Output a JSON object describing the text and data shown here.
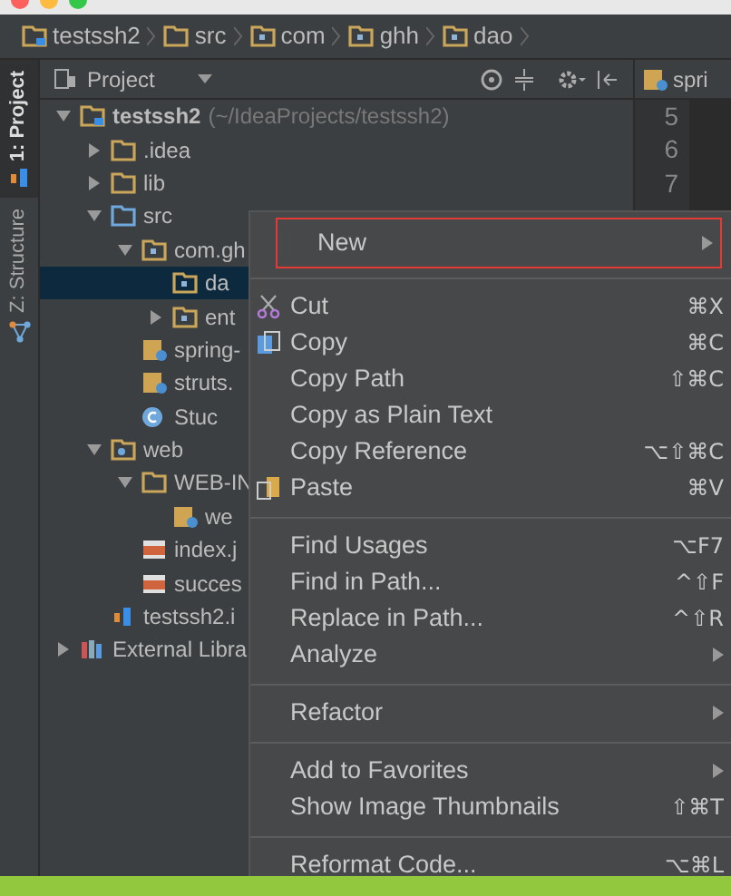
{
  "breadcrumbs": [
    {
      "label": "testssh2",
      "kind": "module"
    },
    {
      "label": "src",
      "kind": "folder"
    },
    {
      "label": "com",
      "kind": "package"
    },
    {
      "label": "ghh",
      "kind": "package"
    },
    {
      "label": "dao",
      "kind": "package"
    }
  ],
  "side_tabs": [
    {
      "label": "1: Project",
      "selected": true
    },
    {
      "label": "Z: Structure",
      "selected": false
    }
  ],
  "project_panel": {
    "title": "Project"
  },
  "tree": [
    {
      "label": "testssh2",
      "hint": "(~/IdeaProjects/testssh2)",
      "kind": "module",
      "expanded": true,
      "selected": false,
      "children": [
        {
          "label": ".idea",
          "kind": "folder",
          "expanded": false,
          "selected": false
        },
        {
          "label": "lib",
          "kind": "folder",
          "expanded": false,
          "selected": false
        },
        {
          "label": "src",
          "kind": "source",
          "expanded": true,
          "selected": false,
          "children": [
            {
              "label": "com.gh",
              "kind": "package",
              "expanded": true,
              "selected": false,
              "children": [
                {
                  "label": "da",
                  "kind": "package",
                  "selected": true
                },
                {
                  "label": "ent",
                  "kind": "package",
                  "expanded": false,
                  "selected": false
                }
              ]
            },
            {
              "label": "spring-",
              "kind": "xml",
              "selected": false
            },
            {
              "label": "struts.",
              "kind": "xml",
              "selected": false
            },
            {
              "label": "Stuc",
              "kind": "class",
              "selected": false
            }
          ]
        },
        {
          "label": "web",
          "kind": "web",
          "expanded": true,
          "selected": false,
          "children": [
            {
              "label": "WEB-IN",
              "kind": "folder",
              "expanded": true,
              "selected": false,
              "children": [
                {
                  "label": "we",
                  "kind": "xml",
                  "selected": false
                }
              ]
            },
            {
              "label": "index.j",
              "kind": "jsp",
              "selected": false
            },
            {
              "label": "succes",
              "kind": "jsp",
              "selected": false
            }
          ]
        },
        {
          "label": "testssh2.i",
          "kind": "iml",
          "selected": false
        }
      ]
    },
    {
      "label": "External Libra",
      "kind": "library",
      "expanded": false,
      "selected": false
    }
  ],
  "editor": {
    "tab": "spri",
    "line_numbers": [
      "5",
      "6",
      "7"
    ]
  },
  "context_menu": [
    {
      "kind": "item",
      "label": "New",
      "submenu": true,
      "highlighted": true
    },
    {
      "kind": "separator"
    },
    {
      "kind": "item",
      "label": "Cut",
      "shortcut": "⌘X"
    },
    {
      "kind": "item",
      "label": "Copy",
      "shortcut": "⌘C"
    },
    {
      "kind": "item",
      "label": "Copy Path",
      "shortcut": "⇧⌘C"
    },
    {
      "kind": "item",
      "label": "Copy as Plain Text"
    },
    {
      "kind": "item",
      "label": "Copy Reference",
      "shortcut": "⌥⇧⌘C"
    },
    {
      "kind": "item",
      "label": "Paste",
      "shortcut": "⌘V"
    },
    {
      "kind": "separator"
    },
    {
      "kind": "item",
      "label": "Find Usages",
      "shortcut": "⌥F7"
    },
    {
      "kind": "item",
      "label": "Find in Path...",
      "shortcut": "^⇧F"
    },
    {
      "kind": "item",
      "label": "Replace in Path...",
      "shortcut": "^⇧R"
    },
    {
      "kind": "item",
      "label": "Analyze",
      "submenu": true
    },
    {
      "kind": "separator"
    },
    {
      "kind": "item",
      "label": "Refactor",
      "submenu": true
    },
    {
      "kind": "separator"
    },
    {
      "kind": "item",
      "label": "Add to Favorites",
      "submenu": true
    },
    {
      "kind": "item",
      "label": "Show Image Thumbnails",
      "shortcut": "⇧⌘T"
    },
    {
      "kind": "separator"
    },
    {
      "kind": "item",
      "label": "Reformat Code...",
      "shortcut": "⌥⌘L"
    }
  ]
}
